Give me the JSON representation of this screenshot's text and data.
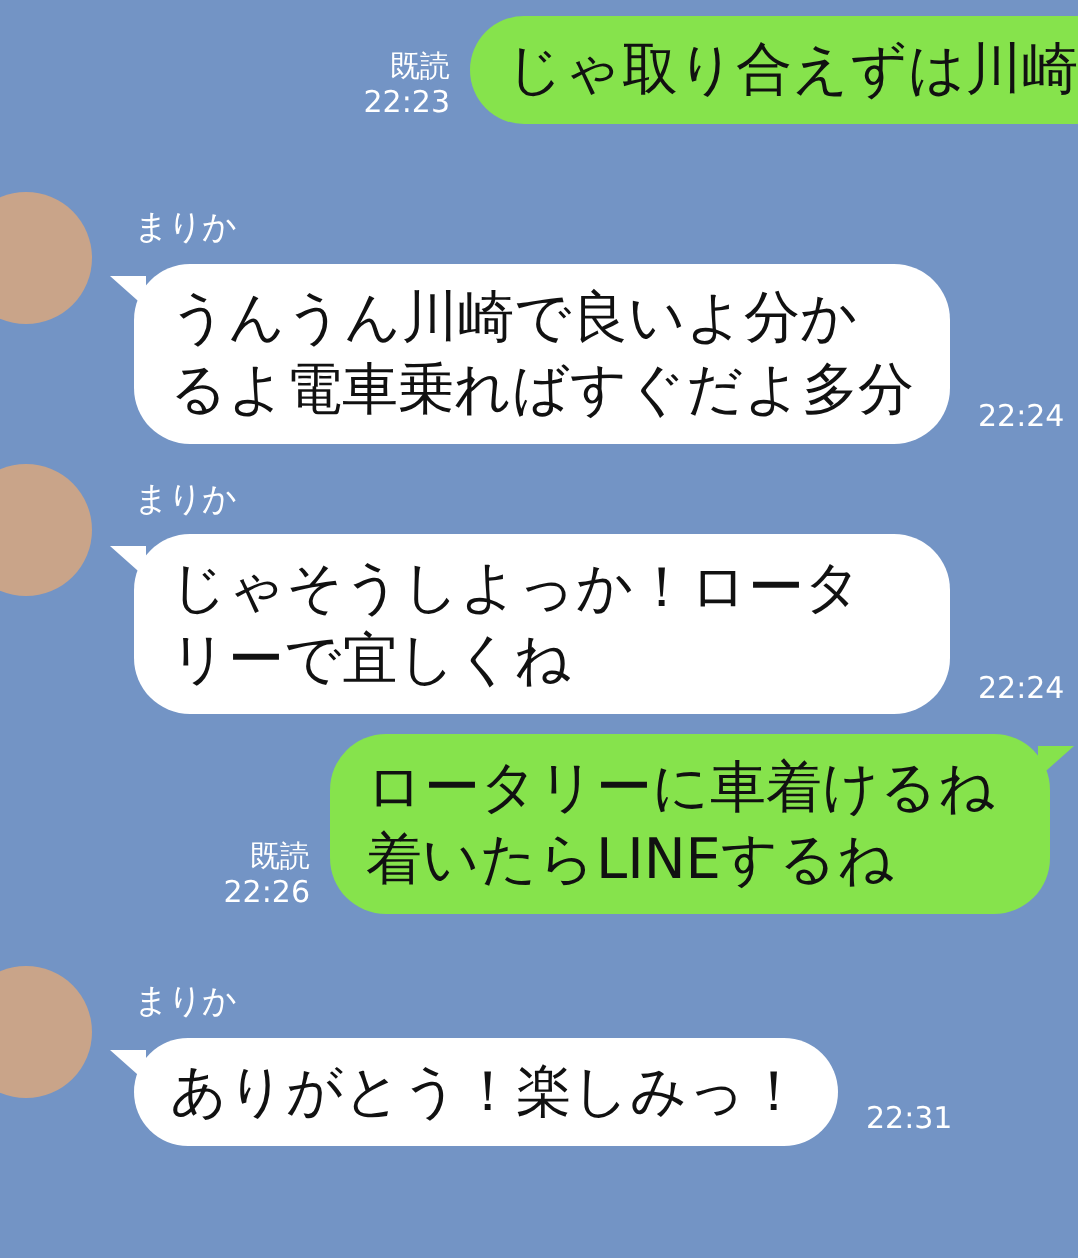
{
  "messages": [
    {
      "kind": "outgoing",
      "read_label": "既読",
      "time": "22:23",
      "text": "じゃ取り合えずは川崎"
    },
    {
      "kind": "incoming",
      "sender": "まりか",
      "text": "うんうん川崎で良いよ分かるよ電車乗ればすぐだよ多分",
      "time": "22:24"
    },
    {
      "kind": "incoming",
      "sender": "まりか",
      "text": "じゃそうしよっか！ロータリーで宜しくね",
      "time": "22:24"
    },
    {
      "kind": "outgoing",
      "read_label": "既読",
      "time": "22:26",
      "text": "ロータリーに車着けるね着いたらLINEするね"
    },
    {
      "kind": "incoming",
      "sender": "まりか",
      "text": "ありがとう！楽しみっ！",
      "time": "22:31"
    }
  ]
}
